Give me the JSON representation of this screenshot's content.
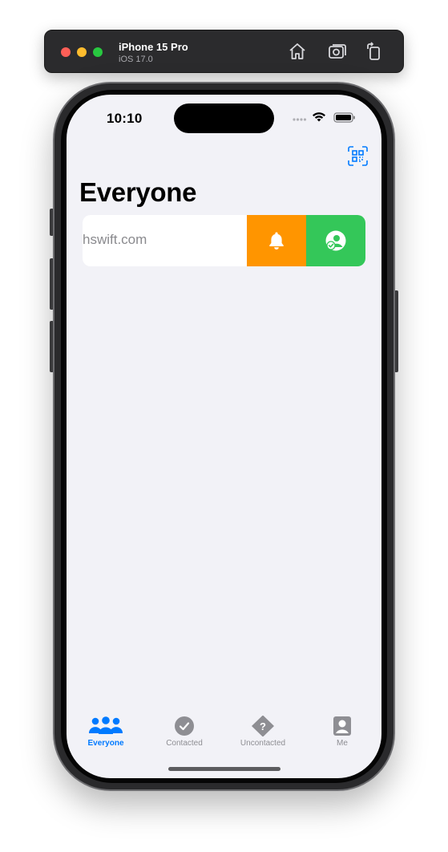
{
  "simulator": {
    "device_name": "iPhone 15 Pro",
    "os_version": "iOS 17.0",
    "toolbar_icons": [
      "home-icon",
      "screenshot-icon",
      "rotate-icon"
    ]
  },
  "status_bar": {
    "time": "10:10",
    "icons": [
      "signal-dots-icon",
      "wifi-icon",
      "battery-icon"
    ]
  },
  "nav": {
    "title": "Everyone",
    "scan_button_icon": "qr-code-scan-icon"
  },
  "list": {
    "rows": [
      {
        "text": "hswift.com",
        "swipe_actions": [
          "bell-icon",
          "person-checkmark-icon"
        ]
      }
    ]
  },
  "tab_bar": {
    "tabs": [
      {
        "label": "Everyone",
        "icon": "people-icon",
        "active": true
      },
      {
        "label": "Contacted",
        "icon": "checkmark-circle-icon",
        "active": false
      },
      {
        "label": "Uncontacted",
        "icon": "questionmark-diamond-icon",
        "active": false
      },
      {
        "label": "Me",
        "icon": "person-square-icon",
        "active": false
      }
    ]
  },
  "colors": {
    "accent": "#007aff",
    "remind_action": "#ff9500",
    "contacted_action": "#34c759",
    "background": "#f2f2f7",
    "inactive_tab": "#8e8e93"
  }
}
